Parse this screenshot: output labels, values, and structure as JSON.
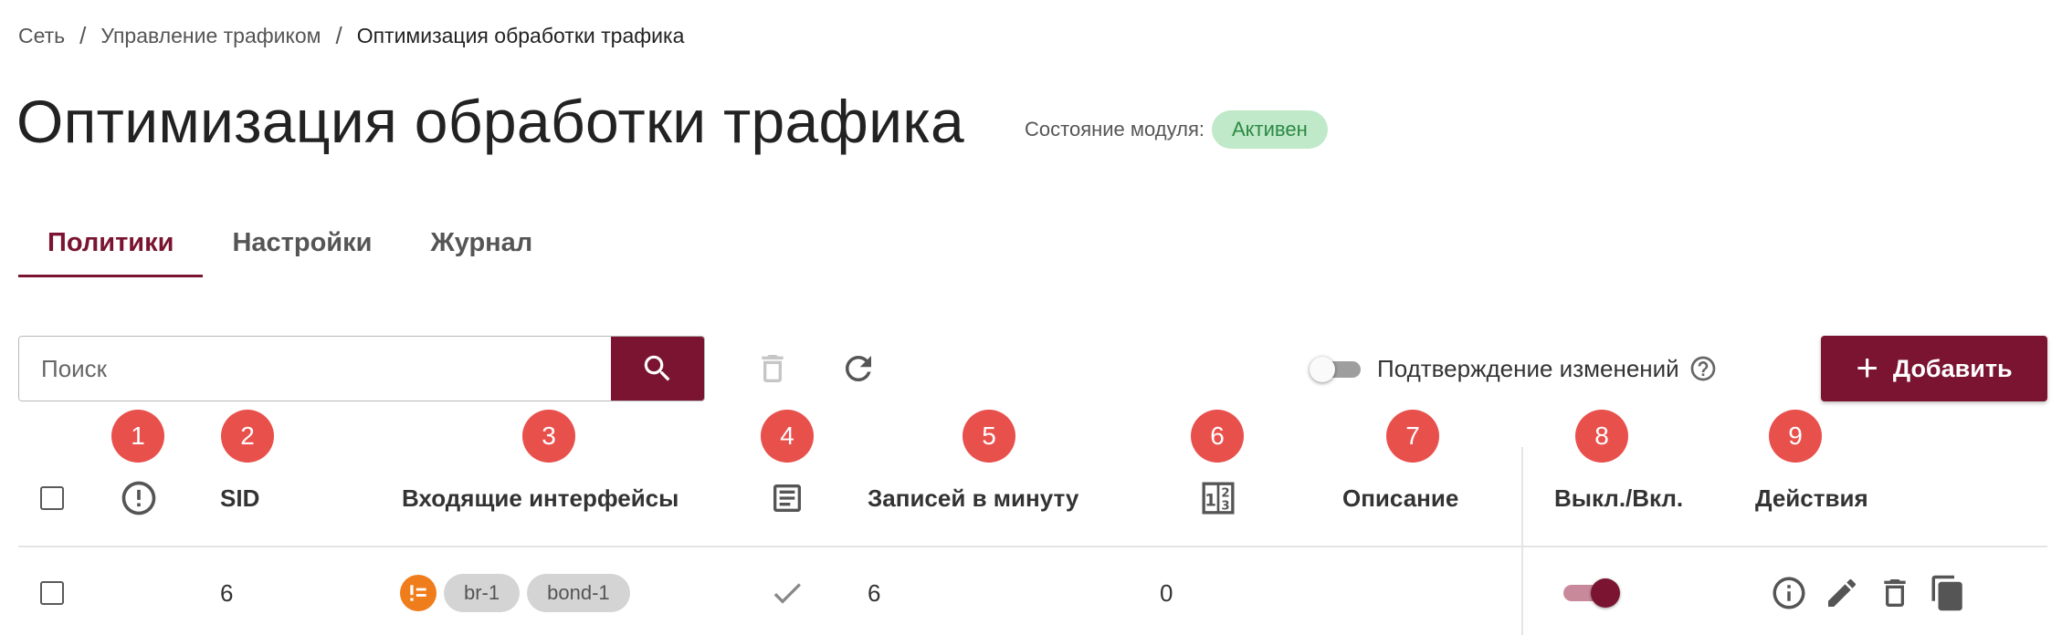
{
  "breadcrumb": {
    "items": [
      "Сеть",
      "Управление трафиком",
      "Оптимизация обработки трафика"
    ],
    "separator": "/"
  },
  "page": {
    "title": "Оптимизация обработки трафика",
    "module_state_label": "Состояние модуля:",
    "module_state_value": "Активен"
  },
  "tabs": [
    {
      "label": "Политики",
      "active": true
    },
    {
      "label": "Настройки",
      "active": false
    },
    {
      "label": "Журнал",
      "active": false
    }
  ],
  "toolbar": {
    "search_placeholder": "Поиск",
    "search_value": "",
    "confirm_changes_label": "Подтверждение изменений",
    "confirm_changes_enabled": false,
    "add_label": "Добавить"
  },
  "markers": [
    "1",
    "2",
    "3",
    "4",
    "5",
    "6",
    "7",
    "8",
    "9"
  ],
  "table": {
    "headers": {
      "sid": "SID",
      "incoming_interfaces": "Входящие интерфейсы",
      "records_per_minute": "Записей в минуту",
      "description": "Описание",
      "toggle": "Выкл./Вкл.",
      "actions": "Действия"
    },
    "rows": [
      {
        "sid": "6",
        "interfaces": [
          "br-1",
          "bond-1"
        ],
        "logging": true,
        "records_per_minute": "6",
        "priority": "0",
        "description": "",
        "enabled": true
      }
    ]
  },
  "colors": {
    "brand": "#7a1430",
    "marker": "#e8504c",
    "status_bg": "#bfe9c8",
    "status_text": "#2c8a44",
    "interface_type": "#f07d1c"
  },
  "icons": {
    "status_header": "alert-circle-outline-icon",
    "log_header": "document-icon",
    "priority_header": "ordered-numbers-icon",
    "search": "search-icon",
    "delete_selected": "trash-icon",
    "refresh": "refresh-icon",
    "help": "help-circle-icon",
    "add": "plus-icon",
    "logging": "check-icon",
    "info": "info-icon",
    "edit": "pencil-icon",
    "delete": "trash-icon",
    "copy": "copy-icon",
    "interface_type": "list-icon"
  }
}
